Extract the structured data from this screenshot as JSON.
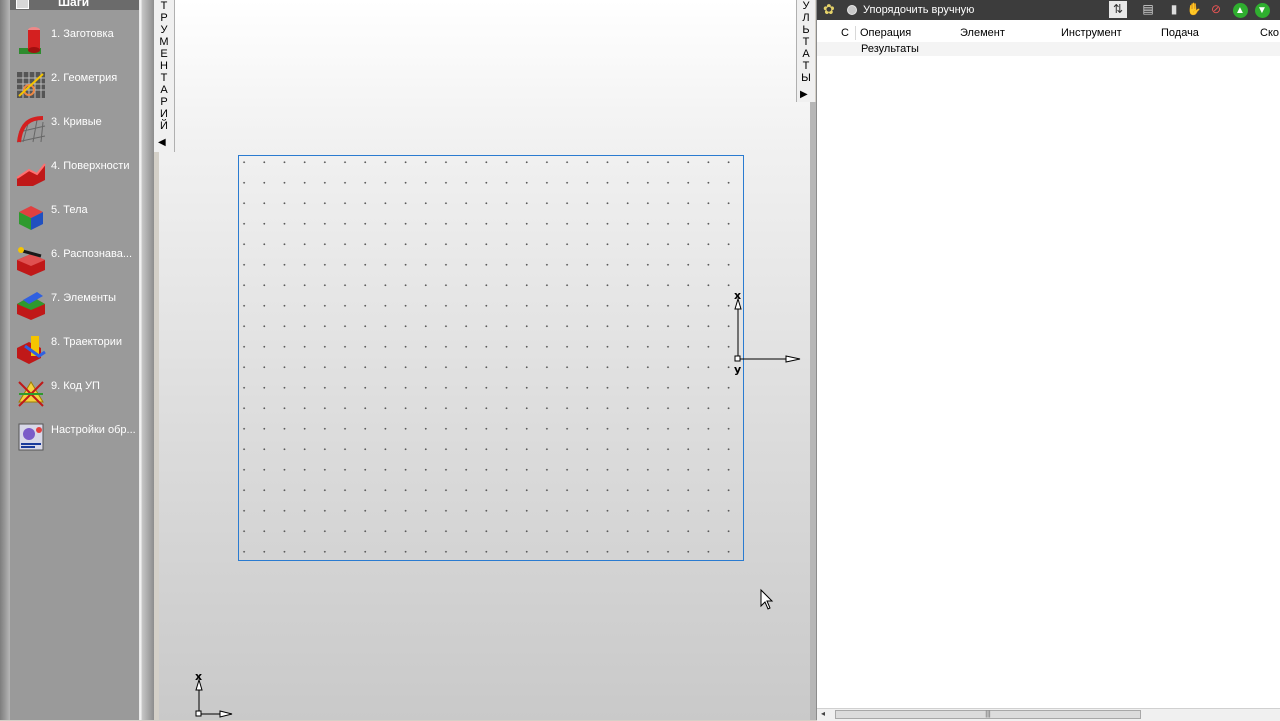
{
  "steps_panel": {
    "title": "Шаги",
    "items": [
      {
        "label": "1.  Заготовка",
        "icon": "stock-cylinder-icon"
      },
      {
        "label": "2.  Геометрия",
        "icon": "geometry-grid-icon"
      },
      {
        "label": "3.  Кривые",
        "icon": "curves-icon"
      },
      {
        "label": "4.  Поверхности",
        "icon": "surfaces-icon"
      },
      {
        "label": "5.  Тела",
        "icon": "solids-icon"
      },
      {
        "label": "6.  Распознава...",
        "icon": "recognition-icon"
      },
      {
        "label": "7.  Элементы",
        "icon": "elements-icon"
      },
      {
        "label": "8.  Траектории",
        "icon": "toolpaths-icon"
      },
      {
        "label": "9.  Код УП",
        "icon": "nc-code-icon"
      },
      {
        "label": "Настройки обр...",
        "icon": "machining-settings-icon"
      }
    ]
  },
  "tools_tab": {
    "label": "ТРУМЕНТАРИЙ",
    "arrow": "◀"
  },
  "results_tab": {
    "label": "УЛЬТАТЫ",
    "arrow": "▶"
  },
  "canvas": {
    "axis_main": {
      "x": "x",
      "y": "y"
    },
    "axis_corner": {
      "x": "x"
    }
  },
  "results_panel": {
    "sort_manually_label": "Упорядочить вручную",
    "columns": [
      "С",
      "Операция",
      "Элемент",
      "Инструмент",
      "Подача",
      "Ско"
    ],
    "group_row": "Результаты",
    "toolbar_icons": [
      "sort-icon",
      "export-icon",
      "delete-icon",
      "hand-icon",
      "no-hand-icon",
      "move-up-icon",
      "move-down-icon"
    ],
    "scroll_thumb": "|||"
  },
  "colors": {
    "frame": "#2a7bd0",
    "panel_dark": "#3c3c3c",
    "green": "#2fae2f"
  }
}
